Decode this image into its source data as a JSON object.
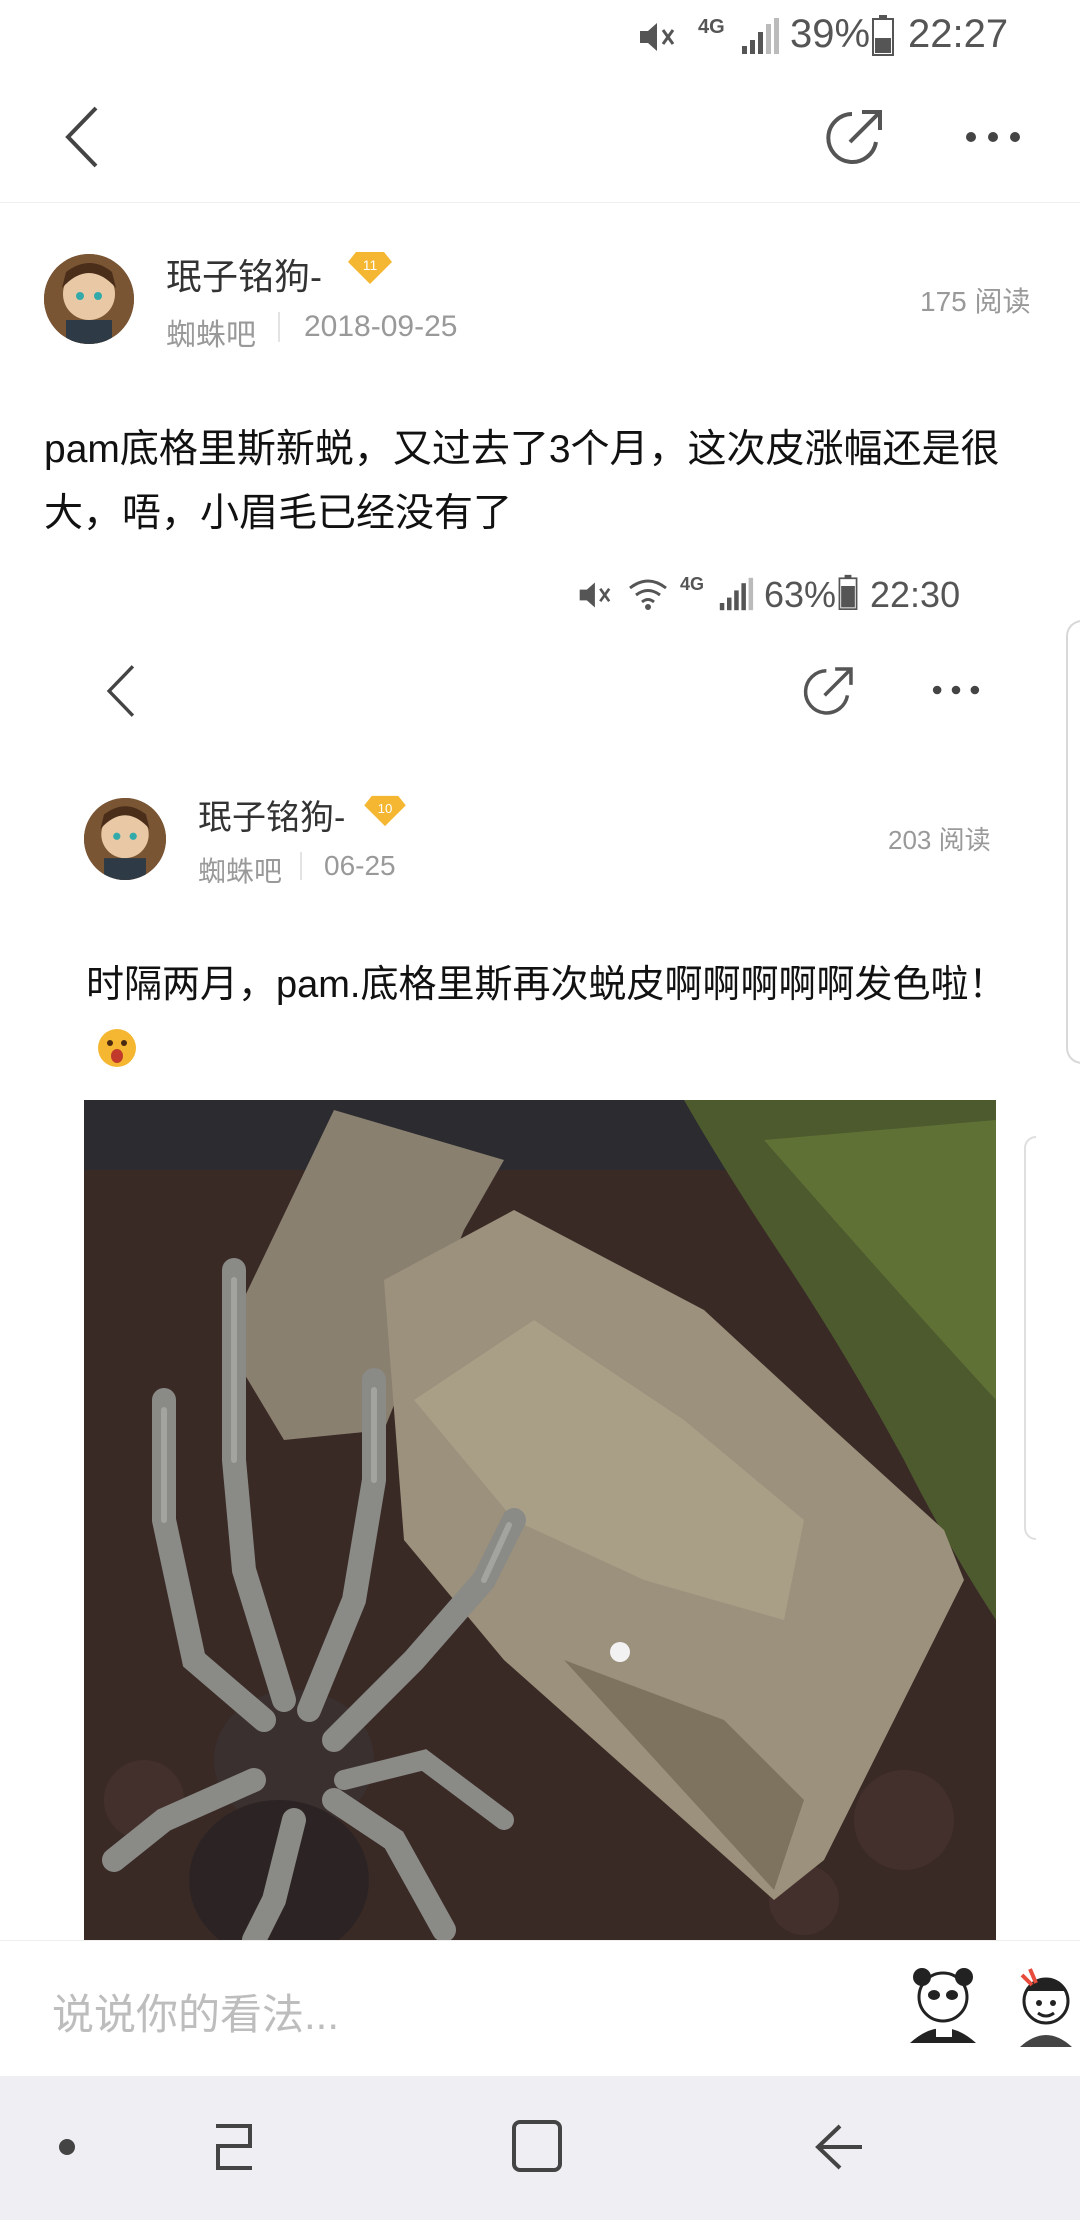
{
  "status_bar": {
    "battery": "39%",
    "time": "22:27",
    "network": "4G"
  },
  "post": {
    "author": "珉子铭狗-",
    "level": "11",
    "forum": "蜘蛛吧",
    "date": "2018-09-25",
    "reads": "175 阅读",
    "content": "pam底格里斯新蜕，又过去了3个月，这次皮涨幅还是很大，唔，小眉毛已经没有了"
  },
  "inner_screenshot": {
    "status_bar": {
      "battery": "63%",
      "time": "22:30",
      "network": "4G"
    },
    "author": "珉子铭狗-",
    "level": "10",
    "forum": "蜘蛛吧",
    "date": "06-25",
    "reads": "203 阅读",
    "content": "时隔两月，pam.底格里斯再次蜕皮啊啊啊啊啊发色啦！"
  },
  "comment_bar": {
    "placeholder": "说说你的看法..."
  },
  "colors": {
    "badge": "#F5B731",
    "text": "#111111",
    "muted": "#999999"
  }
}
